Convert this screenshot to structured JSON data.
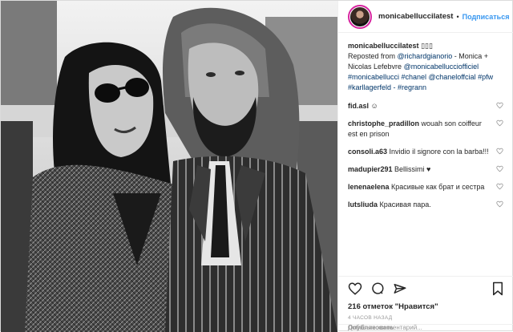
{
  "header": {
    "username": "monicabelluccilatest",
    "separator": "•",
    "follow_label": "Подписаться"
  },
  "caption": {
    "username": "monicabelluccilatest",
    "emoji": "▯▯▯",
    "text_prefix": "Reposted from",
    "mention_1": "@richardgianorio",
    "text_mid": "- Monica + Nicolas Lefebvre",
    "mention_2": "@monicabellucciofficiel",
    "tags": "#monicabellucci #chanel @chaneloffcial #pfw #karllagerfeld - #regrann"
  },
  "comments": [
    {
      "user": "fid.asl",
      "text": "☺"
    },
    {
      "user": "christophe_pradillon",
      "text": "wouah son coiffeur est en prison"
    },
    {
      "user": "consoli.a63",
      "text": "Invidio il signore con la barba!!!"
    },
    {
      "user": "madupier291",
      "text": "Bellissimi ♥"
    },
    {
      "user": "lenenaelena",
      "text": "Красивые как брат и сестра"
    },
    {
      "user": "lutsliuda",
      "text": "Красивая пара."
    }
  ],
  "likes": "216 отметок \"Нравится\"",
  "time": "4 ЧАСОВ НАЗАД",
  "add_comment": {
    "placeholder": "Добавьте комментарий...",
    "publish_label": "Опубликовать"
  }
}
